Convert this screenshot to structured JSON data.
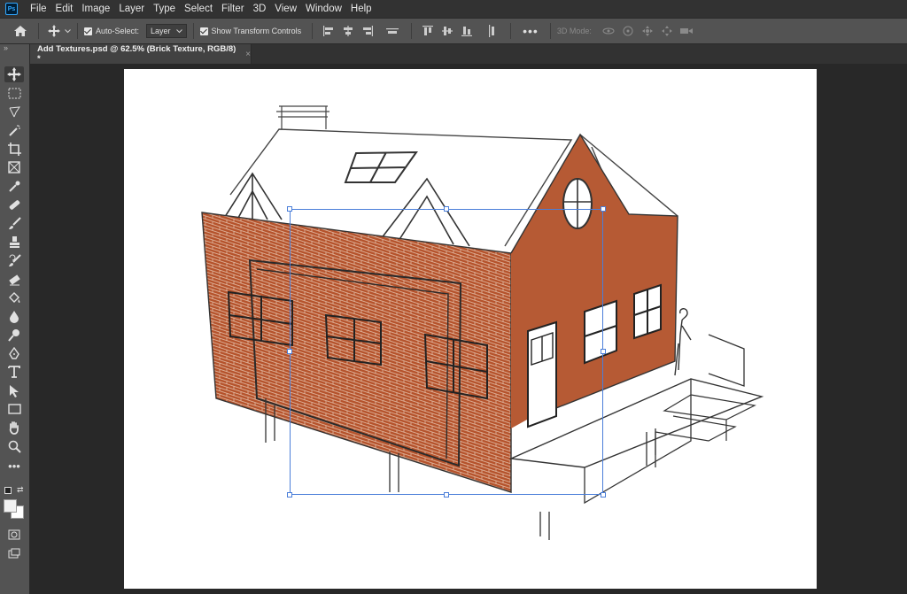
{
  "menubar": {
    "app_logo": "Ps",
    "items": [
      "File",
      "Edit",
      "Image",
      "Layer",
      "Type",
      "Select",
      "Filter",
      "3D",
      "View",
      "Window",
      "Help"
    ]
  },
  "options_bar": {
    "auto_select_label": "Auto-Select:",
    "auto_select_target": "Layer",
    "show_transform_label": "Show Transform Controls",
    "mode_3d_label": "3D Mode:"
  },
  "document_tab": {
    "title": "Add Textures.psd @ 62.5% (Brick Texture, RGB/8) *",
    "close_glyph": "×"
  },
  "toolbar": {
    "collapse_glyph": "»",
    "tools": [
      "move",
      "marquee",
      "lasso",
      "magic-wand",
      "crop",
      "frame",
      "eyedropper",
      "healing",
      "brush",
      "stamp",
      "history-brush",
      "eraser",
      "paint-bucket",
      "blur",
      "dodge",
      "pen",
      "type",
      "path-selection",
      "rectangle",
      "hand",
      "zoom",
      "more"
    ]
  },
  "colors": {
    "accent": "#4a7ed9",
    "brick": "#b5532c",
    "wall": "#b65a34"
  }
}
